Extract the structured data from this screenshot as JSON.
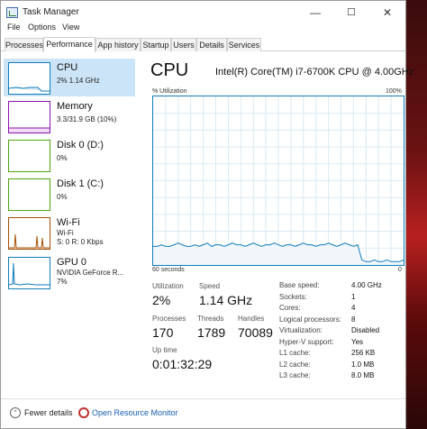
{
  "window": {
    "title": "Task Manager",
    "minimize": "—",
    "maximize": "☐",
    "close": "✕"
  },
  "menu": [
    "File",
    "Options",
    "View"
  ],
  "tabs": [
    "Processes",
    "Performance",
    "App history",
    "Startup",
    "Users",
    "Details",
    "Services"
  ],
  "active_tab": "Performance",
  "sidebar": {
    "items": [
      {
        "title": "CPU",
        "sub1": "2% 1.14 GHz",
        "sub2": "",
        "color": "#117dbb"
      },
      {
        "title": "Memory",
        "sub1": "3.3/31.9 GB (10%)",
        "sub2": "",
        "color": "#8b12ae"
      },
      {
        "title": "Disk 0 (D:)",
        "sub1": "0%",
        "sub2": "",
        "color": "#4da60c"
      },
      {
        "title": "Disk 1 (C:)",
        "sub1": "0%",
        "sub2": "",
        "color": "#4da60c"
      },
      {
        "title": "Wi-Fi",
        "sub1": "Wi-Fi",
        "sub2": "S: 0 R: 0 Kbps",
        "color": "#a74f01"
      },
      {
        "title": "GPU 0",
        "sub1": "NVIDIA GeForce R...",
        "sub2": "7%",
        "color": "#117dbb"
      }
    ]
  },
  "main": {
    "title": "CPU",
    "model": "Intel(R) Core(TM) i7-6700K CPU @ 4.00GHz",
    "util_label": "% Utilization",
    "util_max": "100%",
    "time_label": "60 seconds",
    "zero_label": "0",
    "graph_color": "#117dbb",
    "graph_fill": "#f1f6fa",
    "graph_series": [
      11,
      11,
      12,
      11,
      11,
      12,
      13,
      12,
      11,
      11,
      12,
      11,
      12,
      13,
      11,
      12,
      12,
      11,
      12,
      13,
      12,
      12,
      11,
      12,
      13,
      12,
      11,
      12,
      12,
      13,
      12,
      11,
      12,
      12,
      11,
      12,
      13,
      12,
      12,
      11,
      12,
      12,
      13,
      12,
      11,
      12,
      13,
      12,
      11,
      12,
      3,
      2,
      2,
      3,
      2,
      2,
      3,
      2,
      2,
      2,
      3
    ],
    "stats": {
      "utilization_label": "Utilization",
      "utilization": "2%",
      "speed_label": "Speed",
      "speed": "1.14 GHz",
      "processes_label": "Processes",
      "processes": "170",
      "threads_label": "Threads",
      "threads": "1789",
      "handles_label": "Handles",
      "handles": "70089",
      "uptime_label": "Up time",
      "uptime": "0:01:32:29"
    },
    "specs": [
      [
        "Base speed:",
        "4.00 GHz"
      ],
      [
        "Sockets:",
        "1"
      ],
      [
        "Cores:",
        "4"
      ],
      [
        "Logical processors:",
        "8"
      ],
      [
        "Virtualization:",
        "Disabled"
      ],
      [
        "Hyper-V support:",
        "Yes"
      ],
      [
        "L1 cache:",
        "256 KB"
      ],
      [
        "L2 cache:",
        "1.0 MB"
      ],
      [
        "L3 cache:",
        "8.0 MB"
      ]
    ]
  },
  "footer": {
    "fewer": "Fewer details",
    "resource": "Open Resource Monitor",
    "fewer_icon": "chevron-up-icon",
    "resource_icon": "resource-monitor-icon"
  }
}
